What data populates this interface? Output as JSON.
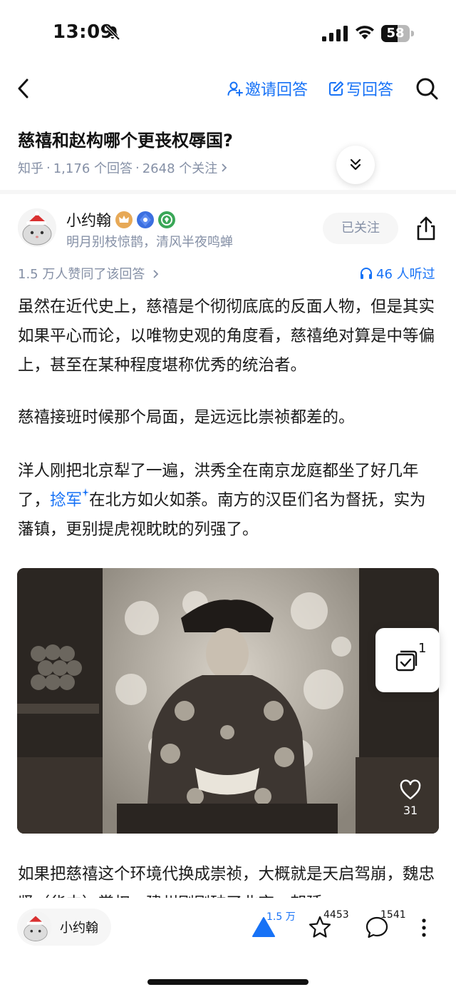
{
  "status_bar": {
    "time": "13:09",
    "battery": "58",
    "battery_level": 0.58
  },
  "nav": {
    "invite_label": "邀请回答",
    "write_label": "写回答"
  },
  "question": {
    "title": "慈禧和赵构哪个更丧权辱国?",
    "source": "知乎",
    "answers": "1,176 个回答",
    "followers": "2648 个关注",
    "sep": "·"
  },
  "author": {
    "name": "小约翰",
    "bio": "明月别枝惊鹊，清风半夜鸣蝉",
    "follow_label": "已关注"
  },
  "answer_meta": {
    "votes_text": "1.5 万人赞同了该回答",
    "listen_text": "46 人听过"
  },
  "content": {
    "p1": "虽然在近代史上，慈禧是个彻彻底底的反面人物，但是其实如果平心而论，以唯物史观的角度看，慈禧绝对算是中等偏上，甚至在某种程度堪称优秀的统治者。",
    "p2": "慈禧接班时候那个局面，是远远比崇祯都差的。",
    "p3_pre": "洋人刚把北京犁了一遍，洪秀全在南京龙庭都坐了好几年了，",
    "p3_link": "捻军",
    "p3_post": "在北方如火如荼。南方的汉臣们名为督抚，实为藩镇，更别提虎视眈眈的列强了。",
    "p4": "如果把慈禧这个环境代换成崇祯，大概就是天启驾崩，魏忠贤（华中）掌权，建州刚刚破了北京，朝廷"
  },
  "image_overlay": {
    "collect_count": "1",
    "like_count": "31"
  },
  "bottom_bar": {
    "author_name": "小约翰",
    "upvotes": "1.5 万",
    "favorites": "4453",
    "comments": "1541"
  },
  "colors": {
    "accent": "#1772f6",
    "muted": "#8590a6"
  }
}
